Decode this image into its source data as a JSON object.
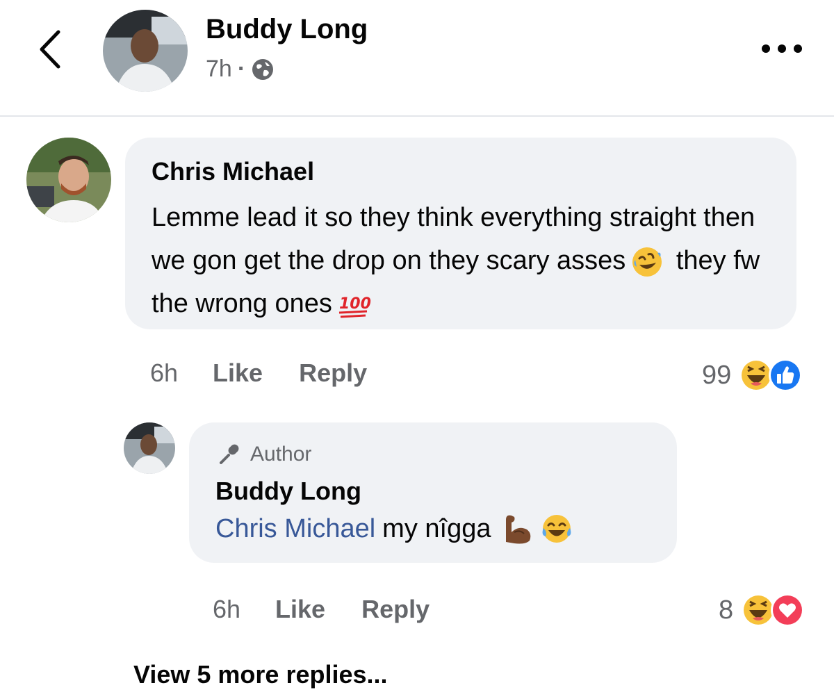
{
  "header": {
    "name": "Buddy Long",
    "time": "7h",
    "separator": "·",
    "privacy_icon": "globe-icon",
    "back_icon": "chevron-left-icon",
    "more_icon": "more-horizontal-icon"
  },
  "comment": {
    "author": "Chris Michael",
    "text_part1": "Lemme lead it so they think everything straight then we gon get the drop on they scary asses",
    "text_part2": "they fw the wrong ones",
    "emojis": [
      "rofl-emoji-icon",
      "hundred-points-icon"
    ],
    "time": "6h",
    "like_label": "Like",
    "reply_label": "Reply",
    "reaction_count": "99",
    "reaction_icons": [
      "haha-reaction-icon",
      "like-reaction-icon"
    ]
  },
  "reply": {
    "badge": "Author",
    "author": "Buddy Long",
    "mention": "Chris Michael",
    "text": "my nîgga",
    "emojis": [
      "flexed-biceps-icon",
      "tears-of-joy-icon"
    ],
    "time": "6h",
    "like_label": "Like",
    "reply_label": "Reply",
    "reaction_count": "8",
    "reaction_icons": [
      "haha-reaction-icon",
      "love-reaction-icon"
    ]
  },
  "view_more": "View 5 more replies...",
  "colors": {
    "bubble": "#f0f2f5",
    "secondary_text": "#65676b",
    "mention": "#385898",
    "like_blue": "#1877f2",
    "love_red": "#f33e58",
    "haha_yellow": "#f7c23a"
  }
}
